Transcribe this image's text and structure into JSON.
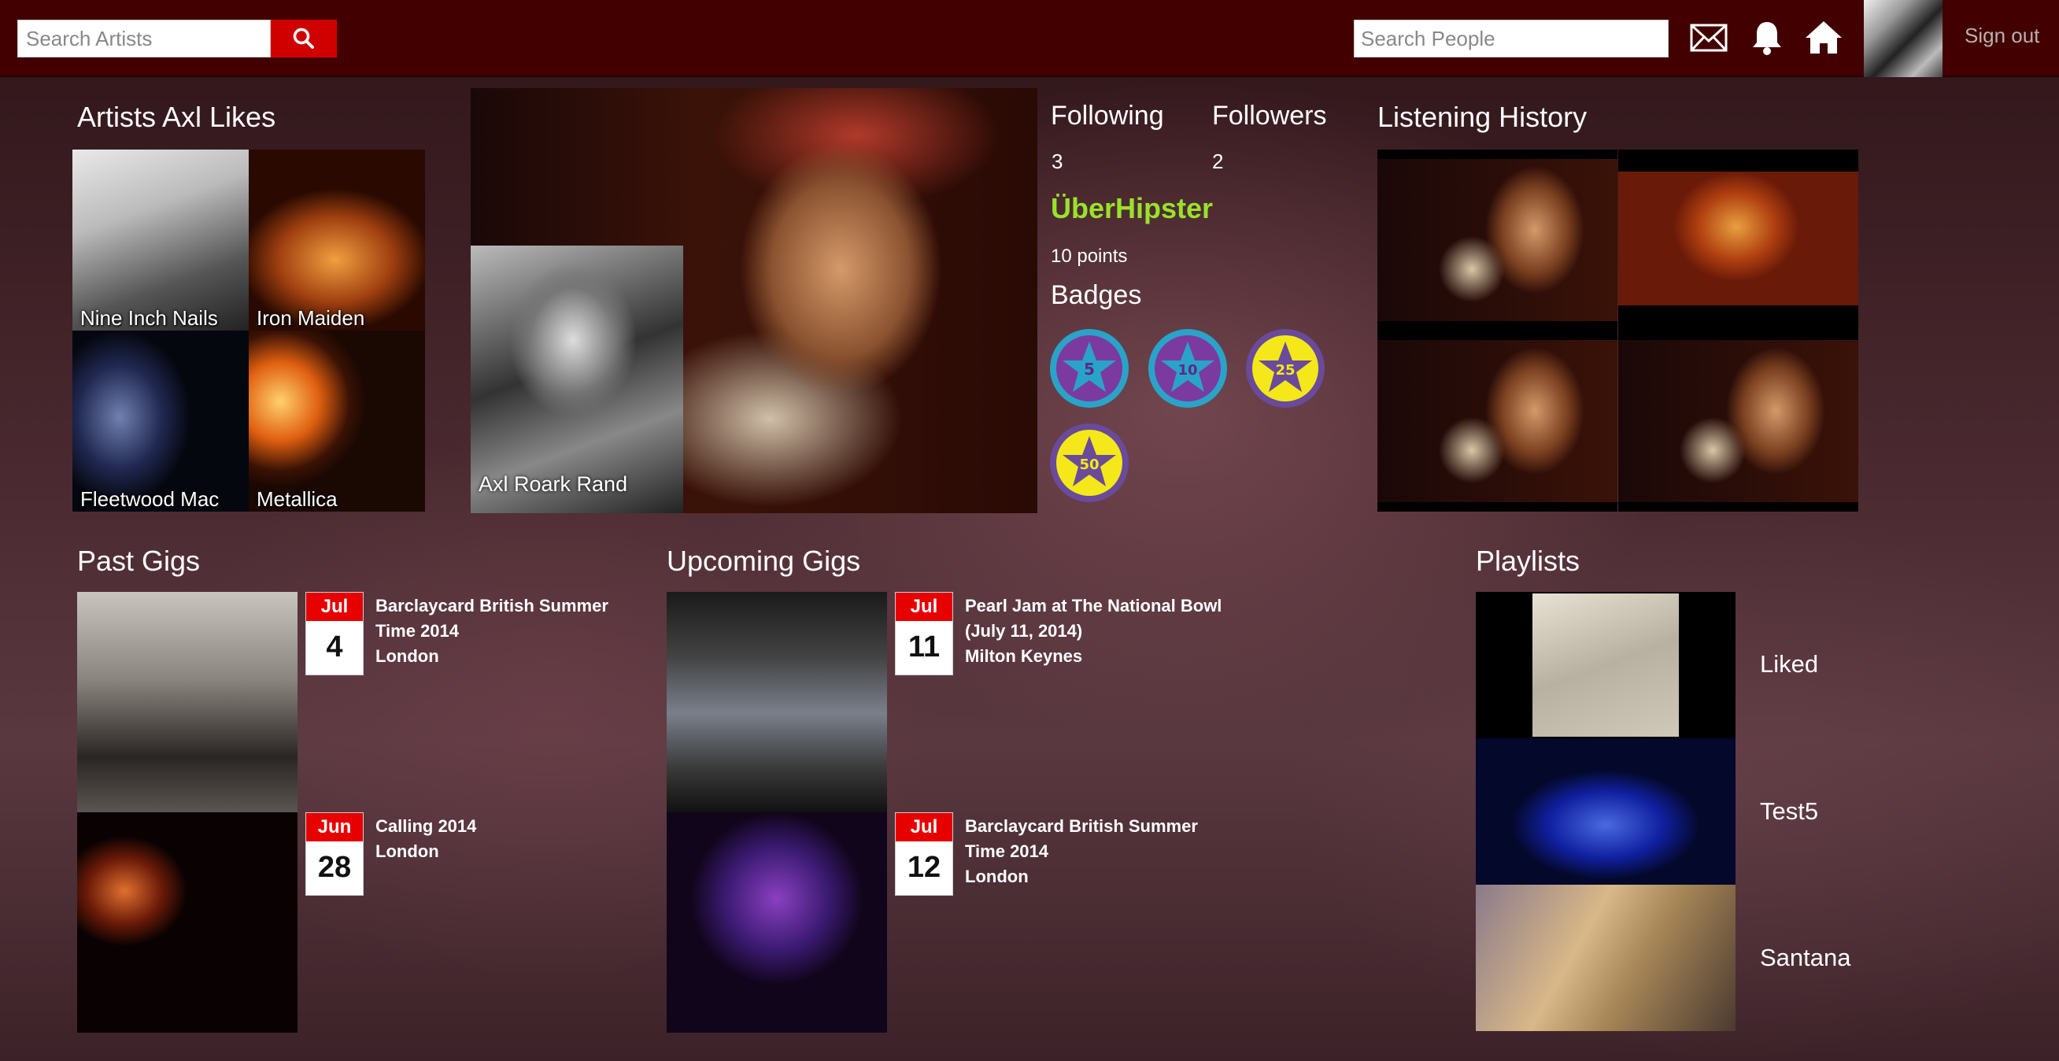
{
  "header": {
    "search_artists_placeholder": "Search Artists",
    "search_people_placeholder": "Search People",
    "sign_out": "Sign out"
  },
  "artists": {
    "title": "Artists Axl Likes",
    "items": [
      {
        "name": "Nine Inch Nails"
      },
      {
        "name": "Iron Maiden"
      },
      {
        "name": "Fleetwood Mac"
      },
      {
        "name": "Metallica"
      }
    ]
  },
  "profile": {
    "name": "Axl Roark Rand",
    "following_label": "Following",
    "following_count": "3",
    "followers_label": "Followers",
    "followers_count": "2",
    "rank": "ÜberHipster",
    "points": "10 points",
    "badges_label": "Badges",
    "badges": [
      "5",
      "10",
      "25",
      "50"
    ]
  },
  "history": {
    "title": "Listening History"
  },
  "past_gigs": {
    "title": "Past Gigs",
    "items": [
      {
        "month": "Jul",
        "day": "4",
        "name": "Barclaycard British Summer Time 2014",
        "city": "London"
      },
      {
        "month": "Jun",
        "day": "28",
        "name": "Calling 2014",
        "city": "London"
      }
    ]
  },
  "upcoming_gigs": {
    "title": "Upcoming Gigs",
    "items": [
      {
        "month": "Jul",
        "day": "11",
        "name": "Pearl Jam at The National Bowl (July 11, 2014)",
        "city": "Milton Keynes"
      },
      {
        "month": "Jul",
        "day": "12",
        "name": "Barclaycard British Summer Time 2014",
        "city": "London"
      }
    ]
  },
  "playlists": {
    "title": "Playlists",
    "items": [
      {
        "name": "Liked"
      },
      {
        "name": "Test5"
      },
      {
        "name": "Santana"
      }
    ]
  },
  "colors": {
    "header_bg": "#420000",
    "search_button": "#d00000",
    "rank_green": "#99e22c",
    "calendar_red": "#e60000"
  }
}
